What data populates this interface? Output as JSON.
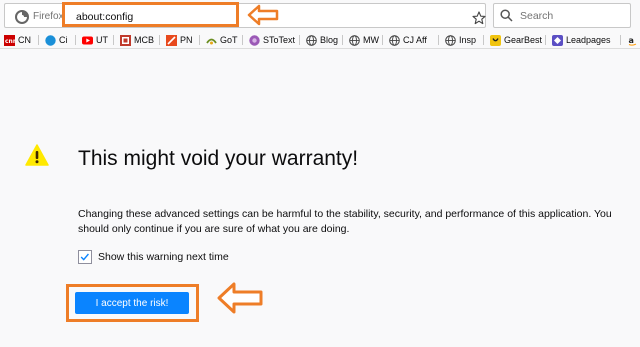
{
  "navbar": {
    "identity_label": "Firefox",
    "url": "about:config",
    "search_placeholder": "Search"
  },
  "bookmarks": [
    {
      "label": "CN",
      "icon": "cn-favicon",
      "color": "#cc0000"
    },
    {
      "label": "Ci",
      "icon": "ci-favicon",
      "color": "#1a8fd8"
    },
    {
      "label": "UT",
      "icon": "youtube-favicon",
      "color": "#ff0000"
    },
    {
      "label": "MCB",
      "icon": "mcb-favicon",
      "color": "#c0392b"
    },
    {
      "label": "PN",
      "icon": "pn-favicon",
      "color": "#e8491d"
    },
    {
      "label": "GoT",
      "icon": "got-favicon",
      "color": "#6b8e23"
    },
    {
      "label": "SToText",
      "icon": "stotext-favicon",
      "color": "#9b59b6"
    },
    {
      "label": "Blog",
      "icon": "globe-icon",
      "color": "#444444"
    },
    {
      "label": "MW",
      "icon": "globe-icon",
      "color": "#444444"
    },
    {
      "label": "CJ Aff",
      "icon": "globe-icon",
      "color": "#444444"
    },
    {
      "label": "Insp",
      "icon": "globe-icon",
      "color": "#444444"
    },
    {
      "label": "GearBest",
      "icon": "gearbest-favicon",
      "color": "#f1c40f"
    },
    {
      "label": "Leadpages",
      "icon": "leadpages-favicon",
      "color": "#5b4fc4"
    },
    {
      "label": "",
      "icon": "amazon-favicon",
      "color": "#222222"
    }
  ],
  "content": {
    "title": "This might void your warranty!",
    "description": "Changing these advanced settings can be harmful to the stability, security, and performance of this application. You should only continue if you are sure of what you are doing.",
    "checkbox_label": "Show this warning next time",
    "checkbox_checked": true,
    "accept_button": "I accept the risk!"
  },
  "colors": {
    "annotation": "#ee7d27",
    "accent": "#0a84ff",
    "warning": "#ffe900"
  }
}
